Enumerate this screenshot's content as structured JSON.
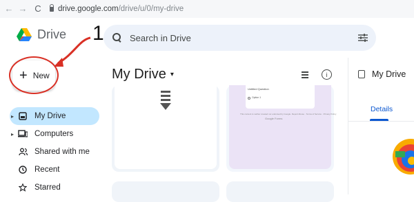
{
  "browser": {
    "back_glyph": "←",
    "forward_glyph": "→",
    "reload_glyph": "C",
    "url_host": "drive.google.com",
    "url_path": "/drive/u/0/my-drive"
  },
  "app": {
    "name": "Drive"
  },
  "annotation": {
    "number": "1",
    "color": "#d93025"
  },
  "search": {
    "placeholder": "Search in Drive"
  },
  "new_button": {
    "plus": "+",
    "label": "New"
  },
  "sidebar": {
    "items": [
      {
        "label": "My Drive",
        "icon": "my-drive-icon",
        "active": true,
        "caret": "▸"
      },
      {
        "label": "Computers",
        "icon": "computer-icon",
        "active": false,
        "caret": "▸"
      },
      {
        "label": "Shared with me",
        "icon": "people-icon",
        "active": false,
        "caret": ""
      },
      {
        "label": "Recent",
        "icon": "clock-icon",
        "active": false,
        "caret": ""
      },
      {
        "label": "Starred",
        "icon": "star-icon",
        "active": false,
        "caret": ""
      }
    ]
  },
  "main": {
    "title": "My Drive",
    "title_caret": "▾"
  },
  "form_preview": {
    "title": "Untitled Question",
    "option": "Option 1",
    "footer": "This content is neither created nor endorsed by Google. Report Abuse · Terms of Service · Privacy Policy",
    "brand": "Google Forms"
  },
  "details_panel": {
    "title": "My Drive",
    "tab": "Details"
  },
  "colors": {
    "accent": "#0b57d0",
    "active_bg": "#c2e7ff",
    "search_bg": "#edf2fa"
  }
}
